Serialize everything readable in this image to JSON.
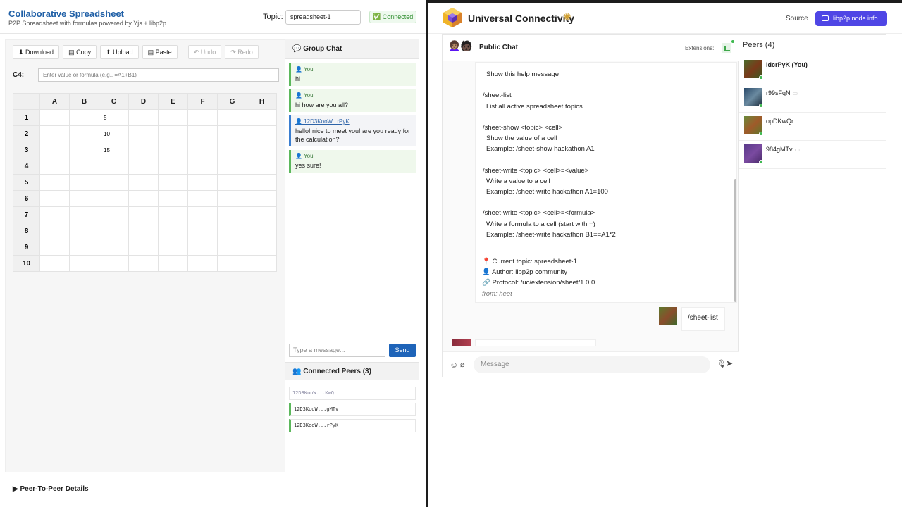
{
  "left_app": {
    "title": "Collaborative Spreadsheet",
    "subtitle": "P2P Spreadsheet with formulas powered by Yjs + libp2p",
    "topic_label": "Topic:",
    "topic_value": "spreadsheet-1",
    "connection_status": "✅ Connected",
    "toolbar": {
      "download": "⬇ Download",
      "copy": "▤ Copy",
      "upload": "⬆ Upload",
      "paste": "▤ Paste",
      "undo": "↶ Undo",
      "redo": "↷ Redo"
    },
    "cell_ref": "C4:",
    "formula_placeholder": "Enter value or formula (e.g., =A1+B1)",
    "columns": [
      "A",
      "B",
      "C",
      "D",
      "E",
      "F",
      "G",
      "H"
    ],
    "rows": [
      "1",
      "2",
      "3",
      "4",
      "5",
      "6",
      "7",
      "8",
      "9",
      "10"
    ],
    "cells": {
      "C1": "5",
      "C2": "10",
      "C3": "15"
    },
    "group_chat": {
      "title": "💬 Group Chat",
      "messages": [
        {
          "author": "👤 You",
          "text": "hi"
        },
        {
          "author": "👤 You",
          "text": "hi how are you all?"
        },
        {
          "author": "👤 12D3KooW...rPyK",
          "text": "hello! nice to meet you! are you ready for the calculation?"
        },
        {
          "author": "👤 You",
          "text": "yes sure!"
        }
      ],
      "input_placeholder": "Type a message...",
      "send_label": "Send"
    },
    "connected_peers": {
      "title": "👥 Connected Peers (3)",
      "peers": [
        "12D3KooW...KwQr",
        "12D3KooW...gMTv",
        "12D3KooW...rPyK"
      ]
    },
    "p2p_details": "▶  Peer-To-Peer Details"
  },
  "right_app": {
    "title": "Universal Connectivity",
    "source_label": "Source",
    "node_info_label": "libp2p node info",
    "chat": {
      "title": "Public Chat",
      "extensions_label": "Extensions:",
      "help_lines": [
        {
          "t": "Show this help message",
          "ind": true
        },
        {
          "t": "",
          "gap": true
        },
        {
          "t": "/sheet-list",
          "ind": false
        },
        {
          "t": "List all active spreadsheet topics",
          "ind": true
        },
        {
          "t": "",
          "gap": true
        },
        {
          "t": "/sheet-show <topic> <cell>",
          "ind": false
        },
        {
          "t": "Show the value of a cell",
          "ind": true
        },
        {
          "t": "Example: /sheet-show hackathon A1",
          "ind": true
        },
        {
          "t": "",
          "gap": true
        },
        {
          "t": "/sheet-write <topic> <cell>=<value>",
          "ind": false
        },
        {
          "t": "Write a value to a cell",
          "ind": true
        },
        {
          "t": "Example: /sheet-write hackathon A1=100",
          "ind": true
        },
        {
          "t": "",
          "gap": true
        },
        {
          "t": "/sheet-write <topic> <cell>=<formula>",
          "ind": false
        },
        {
          "t": "Write a formula to a cell (start with =)",
          "ind": true
        },
        {
          "t": "Example: /sheet-write hackathon B1==A1*2",
          "ind": true
        }
      ],
      "meta": {
        "topic": "📍 Current topic: spreadsheet-1",
        "author": "👤 Author: libp2p community",
        "protocol": "🔗 Protocol: /uc/extension/sheet/1.0.0",
        "from": "from: heet"
      },
      "my_message": "/sheet-list",
      "message_placeholder": "Message"
    },
    "peers": {
      "title": "Peers (4)",
      "items": [
        {
          "name": "idcrPyK (You)",
          "bold": true,
          "chat": false,
          "online": true
        },
        {
          "name": "r99sFqN",
          "bold": false,
          "chat": true,
          "online": true
        },
        {
          "name": "opDKwQr",
          "bold": false,
          "chat": false,
          "online": true
        },
        {
          "name": "984gMTv",
          "bold": false,
          "chat": true,
          "online": true
        }
      ]
    }
  }
}
